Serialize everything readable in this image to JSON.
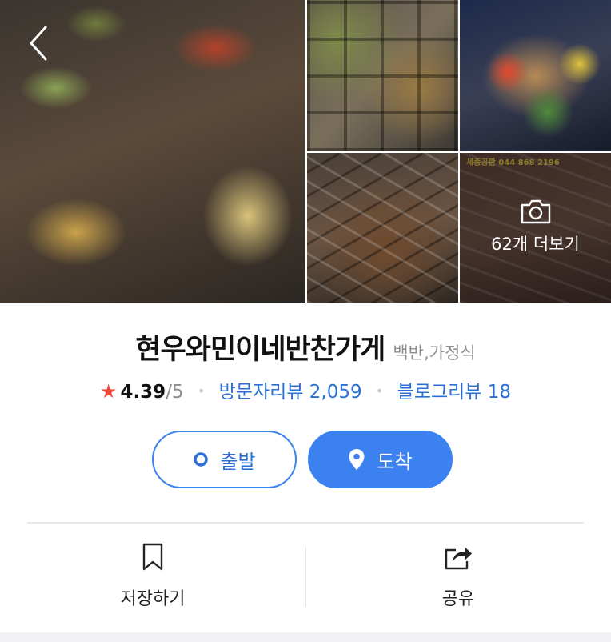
{
  "gallery": {
    "more_photos_label": "62개 더보기",
    "sign_text": "세종공판 044 868 2196"
  },
  "place": {
    "name": "현우와민이네반찬가게",
    "category": "백반,가정식",
    "rating": "4.39",
    "rating_max": "/5",
    "visitor_reviews_label": "방문자리뷰 2,059",
    "blog_reviews_label": "블로그리뷰 18",
    "star_symbol": "★",
    "separator": "•"
  },
  "buttons": {
    "depart_label": "출발",
    "arrive_label": "도착"
  },
  "actions": {
    "save_label": "저장하기",
    "share_label": "공유"
  },
  "colors": {
    "accent_blue": "#3b82f0",
    "link_blue": "#2b6fd6",
    "star_red": "#f0483b",
    "muted_gray": "#8e8e8e"
  },
  "icons": [
    "back-arrow-icon",
    "camera-icon",
    "target-dot-icon",
    "location-pin-icon",
    "bookmark-icon",
    "share-icon"
  ]
}
